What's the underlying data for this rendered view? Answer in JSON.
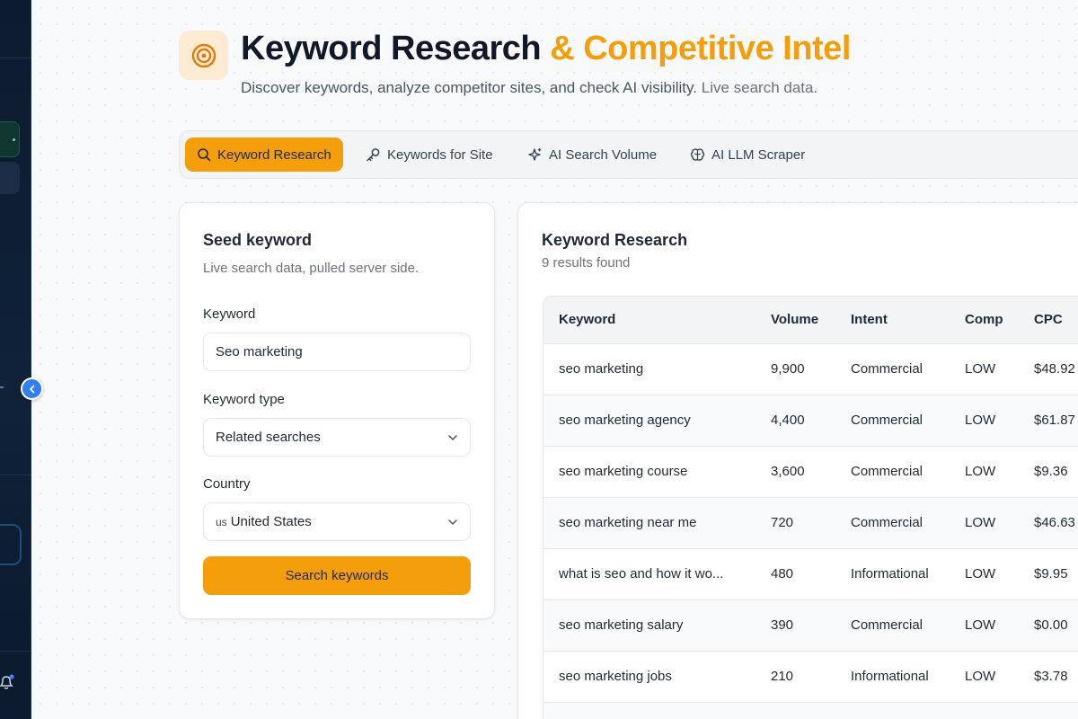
{
  "header": {
    "title_main": "Keyword Research",
    "title_accent": "& Competitive Intel",
    "subtitle_main": "Discover keywords, analyze competitor sites, and check AI visibility.",
    "subtitle_muted": "Live search data."
  },
  "tabs": [
    {
      "label": "Keyword Research",
      "icon": "search-icon",
      "active": true
    },
    {
      "label": "Keywords for Site",
      "icon": "key-icon",
      "active": false
    },
    {
      "label": "AI Search Volume",
      "icon": "sparkles-icon",
      "active": false
    },
    {
      "label": "AI LLM Scraper",
      "icon": "brain-icon",
      "active": false
    }
  ],
  "form": {
    "title": "Seed keyword",
    "subtitle": "Live search data, pulled server side.",
    "keyword_label": "Keyword",
    "keyword_value": "Seo marketing",
    "type_label": "Keyword type",
    "type_value": "Related searches",
    "country_label": "Country",
    "country_code": "us",
    "country_value": "United States",
    "submit_label": "Search keywords"
  },
  "results": {
    "title": "Keyword Research",
    "count_text": "9 results found",
    "columns": [
      "Keyword",
      "Volume",
      "Intent",
      "Comp",
      "CPC"
    ],
    "rows": [
      [
        "seo marketing",
        "9,900",
        "Commercial",
        "LOW",
        "$48.92"
      ],
      [
        "seo marketing agency",
        "4,400",
        "Commercial",
        "LOW",
        "$61.87"
      ],
      [
        "seo marketing course",
        "3,600",
        "Commercial",
        "LOW",
        "$9.36"
      ],
      [
        "seo marketing near me",
        "720",
        "Commercial",
        "LOW",
        "$46.63"
      ],
      [
        "what is seo and how it wo...",
        "480",
        "Informational",
        "LOW",
        "$9.95"
      ],
      [
        "seo marketing salary",
        "390",
        "Commercial",
        "LOW",
        "$0.00"
      ],
      [
        "seo marketing jobs",
        "210",
        "Informational",
        "LOW",
        "$3.78"
      ]
    ]
  },
  "colors": {
    "accent": "#f59e0b",
    "sidebar": "#0f2238",
    "collapse_button": "#2f80ed"
  }
}
